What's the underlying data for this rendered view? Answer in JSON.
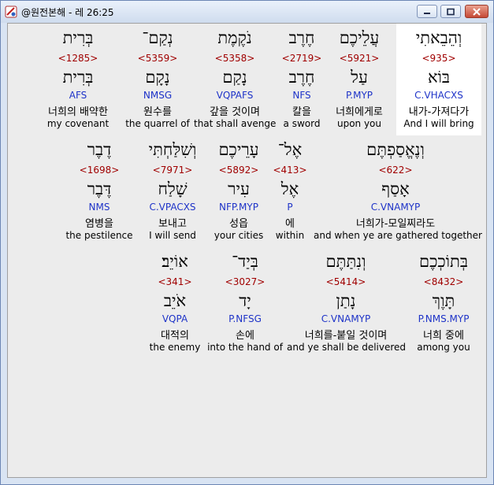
{
  "window": {
    "title": "@원전본해 - 레 26:25"
  },
  "words": [
    {
      "hebrew": "וְהֵבֵאתִי",
      "strong": "<935>",
      "root": "בּוֹא",
      "morph": "C.VHACXS",
      "korean": "내가-가져다가",
      "english": "And I will bring",
      "highlighted": true
    },
    {
      "hebrew": "עֲלֵיכֶם",
      "strong": "<5921>",
      "root": "עַל",
      "morph": "P.MYP",
      "korean": "너희에게로",
      "english": "upon you"
    },
    {
      "hebrew": "חֶרֶב",
      "strong": "<2719>",
      "root": "חֶרֶב",
      "morph": "NFS",
      "korean": "칼을",
      "english": "a sword"
    },
    {
      "hebrew": "נֹקֶמֶת",
      "strong": "<5358>",
      "root": "נָקַם",
      "morph": "VQPAFS",
      "korean": "갚을 것이며",
      "english": "that shall avenge"
    },
    {
      "hebrew": "נְקַם־",
      "strong": "<5359>",
      "root": "נָקָם",
      "morph": "NMSG",
      "korean": "원수를",
      "english": "the quarrel of"
    },
    {
      "hebrew": "בְּרִית",
      "strong": "<1285>",
      "root": "בְּרִית",
      "morph": "AFS",
      "korean": "너희의 배약한",
      "english": "my covenant"
    },
    {
      "hebrew": "וְנֶאֱסַפְתֶּם",
      "strong": "<622>",
      "root": "אָסַף",
      "morph": "C.VNAMYP",
      "korean": "너희가-모일찌라도",
      "english": "and when ye are gathered together"
    },
    {
      "hebrew": "אֶל־",
      "strong": "<413>",
      "root": "אֶל",
      "morph": "P",
      "korean": "에",
      "english": "within"
    },
    {
      "hebrew": "עָרֵיכֶם",
      "strong": "<5892>",
      "root": "עִיר",
      "morph": "NFP.MYP",
      "korean": "성읍",
      "english": "your cities"
    },
    {
      "hebrew": "וְשִׁלַּחְתִּי",
      "strong": "<7971>",
      "root": "שָׁלַח",
      "morph": "C.VPACXS",
      "korean": "보내고",
      "english": "I will send"
    },
    {
      "hebrew": "דֶבֶר",
      "strong": "<1698>",
      "root": "דֶּבֶר",
      "morph": "NMS",
      "korean": "염병을",
      "english": "the pestilence"
    },
    {
      "hebrew": "בְּתוֹכְכֶם",
      "strong": "<8432>",
      "root": "תָּוֶךְ",
      "morph": "P.NMS.MYP",
      "korean": "너희 중에",
      "english": "among you"
    },
    {
      "hebrew": "וְנִתַּתֶּם",
      "strong": "<5414>",
      "root": "נָתַן",
      "morph": "C.VNAMYP",
      "korean": "너희를-붙일 것이며",
      "english": "and ye shall be delivered"
    },
    {
      "hebrew": "בְּיַד־",
      "strong": "<3027>",
      "root": "יָד",
      "morph": "P.NFSG",
      "korean": "손에",
      "english": "into the hand of"
    },
    {
      "hebrew": "אוֹיֵב׃",
      "strong": "<341>",
      "root": "אֹיֵב",
      "morph": "VQPA",
      "korean": "대적의",
      "english": "the enemy"
    }
  ]
}
